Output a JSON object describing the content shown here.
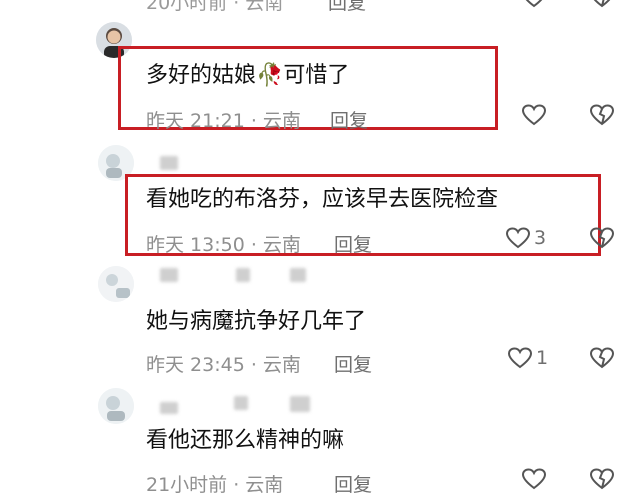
{
  "top_partial": {
    "meta": "20小时前 · 云南",
    "reply": "回复"
  },
  "comments": [
    {
      "text": "多好的姑娘🥀可惜了",
      "time": "昨天 21:21 · 云南",
      "reply": "回复",
      "likes": ""
    },
    {
      "text": "看她吃的布洛芬，应该早去医院检查",
      "time": "昨天 13:50 · 云南",
      "reply": "回复",
      "likes": "3"
    },
    {
      "text": "她与病魔抗争好几年了",
      "time": "昨天 23:45 · 云南",
      "reply": "回复",
      "likes": "1"
    },
    {
      "text": "看他还那么精神的嘛",
      "time": "21小时前 · 云南",
      "reply": "回复",
      "likes": ""
    }
  ],
  "colors": {
    "highlight_box": "#c81e24",
    "meta_text": "#8f8f8f"
  },
  "icons": {
    "like": "heart-outline-icon",
    "dislike": "broken-heart-icon"
  }
}
